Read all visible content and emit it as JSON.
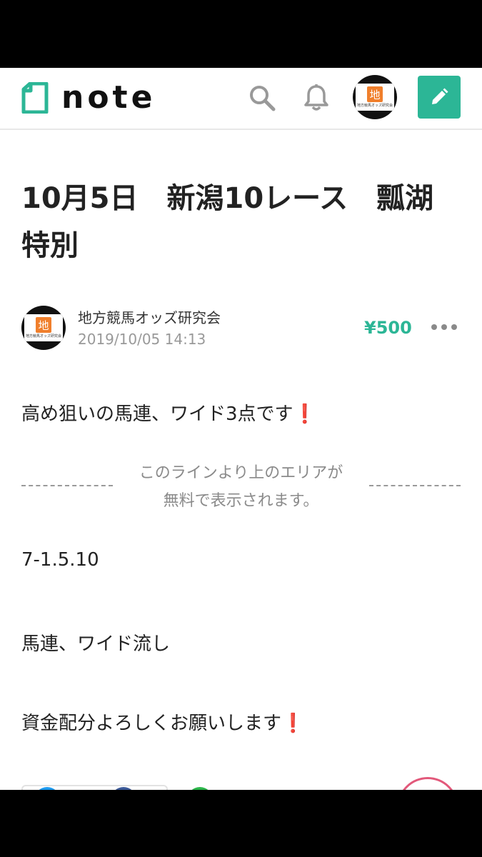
{
  "header": {
    "logo_text": "note",
    "search_icon": "search-icon",
    "bell_icon": "bell-icon",
    "write_icon": "pencil-icon",
    "accent": "#2cb696"
  },
  "avatar": {
    "glyph": "地",
    "caption": "地方競馬オッズ研究会",
    "square_color": "#f07f2c"
  },
  "article": {
    "title": "10月5日　新潟10レース　瓢湖特別",
    "author": "地方競馬オッズ研究会",
    "date": "2019/10/05 14:13",
    "price": "¥500",
    "line1": "高め狙いの馬連、ワイド3点です",
    "paywall_line1": "このラインより上のエリアが",
    "paywall_line2": "無料で表示されます。",
    "line2": "7-1.5.10",
    "line3": "馬連、ワイド流し",
    "line4": "資金配分よろしくお願いします",
    "exclamation": "❗"
  }
}
